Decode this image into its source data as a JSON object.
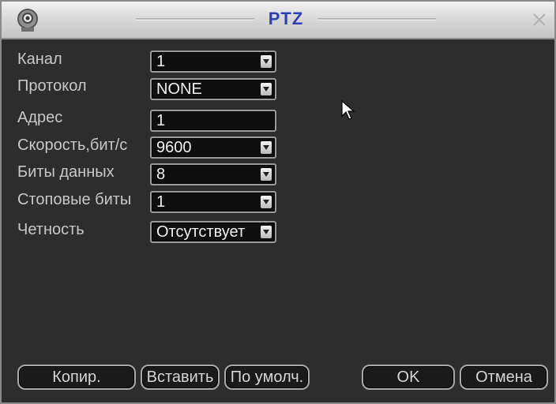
{
  "window": {
    "title": "PTZ",
    "close_glyph": "✕"
  },
  "form": {
    "channel": {
      "label": "Канал",
      "value": "1"
    },
    "protocol": {
      "label": "Протокол",
      "value": "NONE"
    },
    "address": {
      "label": "Адрес",
      "value": "1"
    },
    "baud_rate": {
      "label": "Скорость,бит/с",
      "value": "9600"
    },
    "data_bits": {
      "label": "Биты данных",
      "value": "8"
    },
    "stop_bits": {
      "label": "Стоповые биты",
      "value": "1"
    },
    "parity": {
      "label": "Четность",
      "value": "Отсутствует"
    }
  },
  "buttons": {
    "copy": "Копир.",
    "paste": "Вставить",
    "default": "По умолч.",
    "ok": "OK",
    "cancel": "Отмена"
  },
  "icons": {
    "app": "camera-icon",
    "close": "close-icon",
    "dropdown": "triangle-down-icon",
    "cursor": "mouse-pointer-icon"
  },
  "colors": {
    "title_text": "#2f3fb4",
    "panel_bg": "#2d2d2d",
    "field_bg": "#0f0f0f",
    "label_text": "#c8c8c8"
  }
}
